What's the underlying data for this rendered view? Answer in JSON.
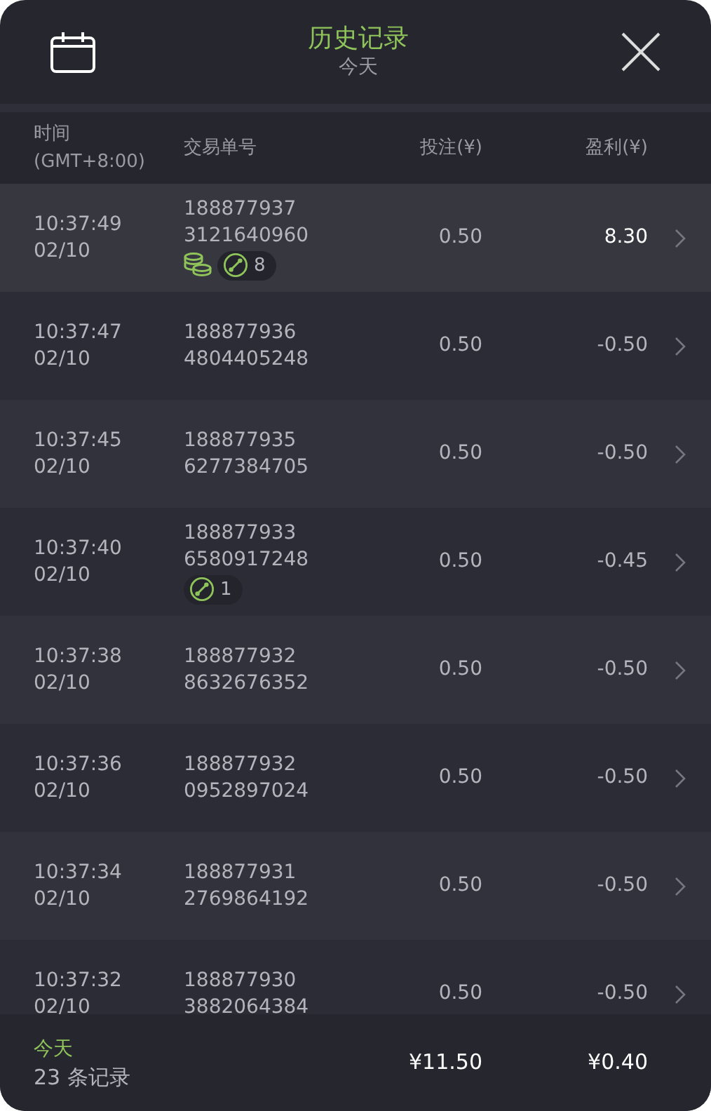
{
  "header": {
    "title": "历史记录",
    "subtitle": "今天"
  },
  "columns": {
    "time": "时间",
    "timezone": "(GMT+8:00)",
    "order": "交易单号",
    "stake": "投注(¥)",
    "profit": "盈利(¥)"
  },
  "rows": [
    {
      "time": "10:37:49",
      "date": "02/10",
      "order_a": "188877937",
      "order_b": "3121640960",
      "coins": true,
      "combo": "8",
      "stake": "0.50",
      "profit": "8.30",
      "win": true
    },
    {
      "time": "10:37:47",
      "date": "02/10",
      "order_a": "188877936",
      "order_b": "4804405248",
      "coins": false,
      "stake": "0.50",
      "profit": "-0.50",
      "win": false
    },
    {
      "time": "10:37:45",
      "date": "02/10",
      "order_a": "188877935",
      "order_b": "6277384705",
      "coins": false,
      "stake": "0.50",
      "profit": "-0.50",
      "win": false
    },
    {
      "time": "10:37:40",
      "date": "02/10",
      "order_a": "188877933",
      "order_b": "6580917248",
      "coins": false,
      "combo": "1",
      "stake": "0.50",
      "profit": "-0.45",
      "win": false
    },
    {
      "time": "10:37:38",
      "date": "02/10",
      "order_a": "188877932",
      "order_b": "8632676352",
      "coins": false,
      "stake": "0.50",
      "profit": "-0.50",
      "win": false
    },
    {
      "time": "10:37:36",
      "date": "02/10",
      "order_a": "188877932",
      "order_b": "0952897024",
      "coins": false,
      "stake": "0.50",
      "profit": "-0.50",
      "win": false
    },
    {
      "time": "10:37:34",
      "date": "02/10",
      "order_a": "188877931",
      "order_b": "2769864192",
      "coins": false,
      "stake": "0.50",
      "profit": "-0.50",
      "win": false
    },
    {
      "time": "10:37:32",
      "date": "02/10",
      "order_a": "188877930",
      "order_b": "3882064384",
      "coins": false,
      "stake": "0.50",
      "profit": "-0.50",
      "win": false
    }
  ],
  "footer": {
    "period": "今天",
    "count": "23 条记录",
    "total_stake": "¥11.50",
    "total_profit": "¥0.40"
  }
}
